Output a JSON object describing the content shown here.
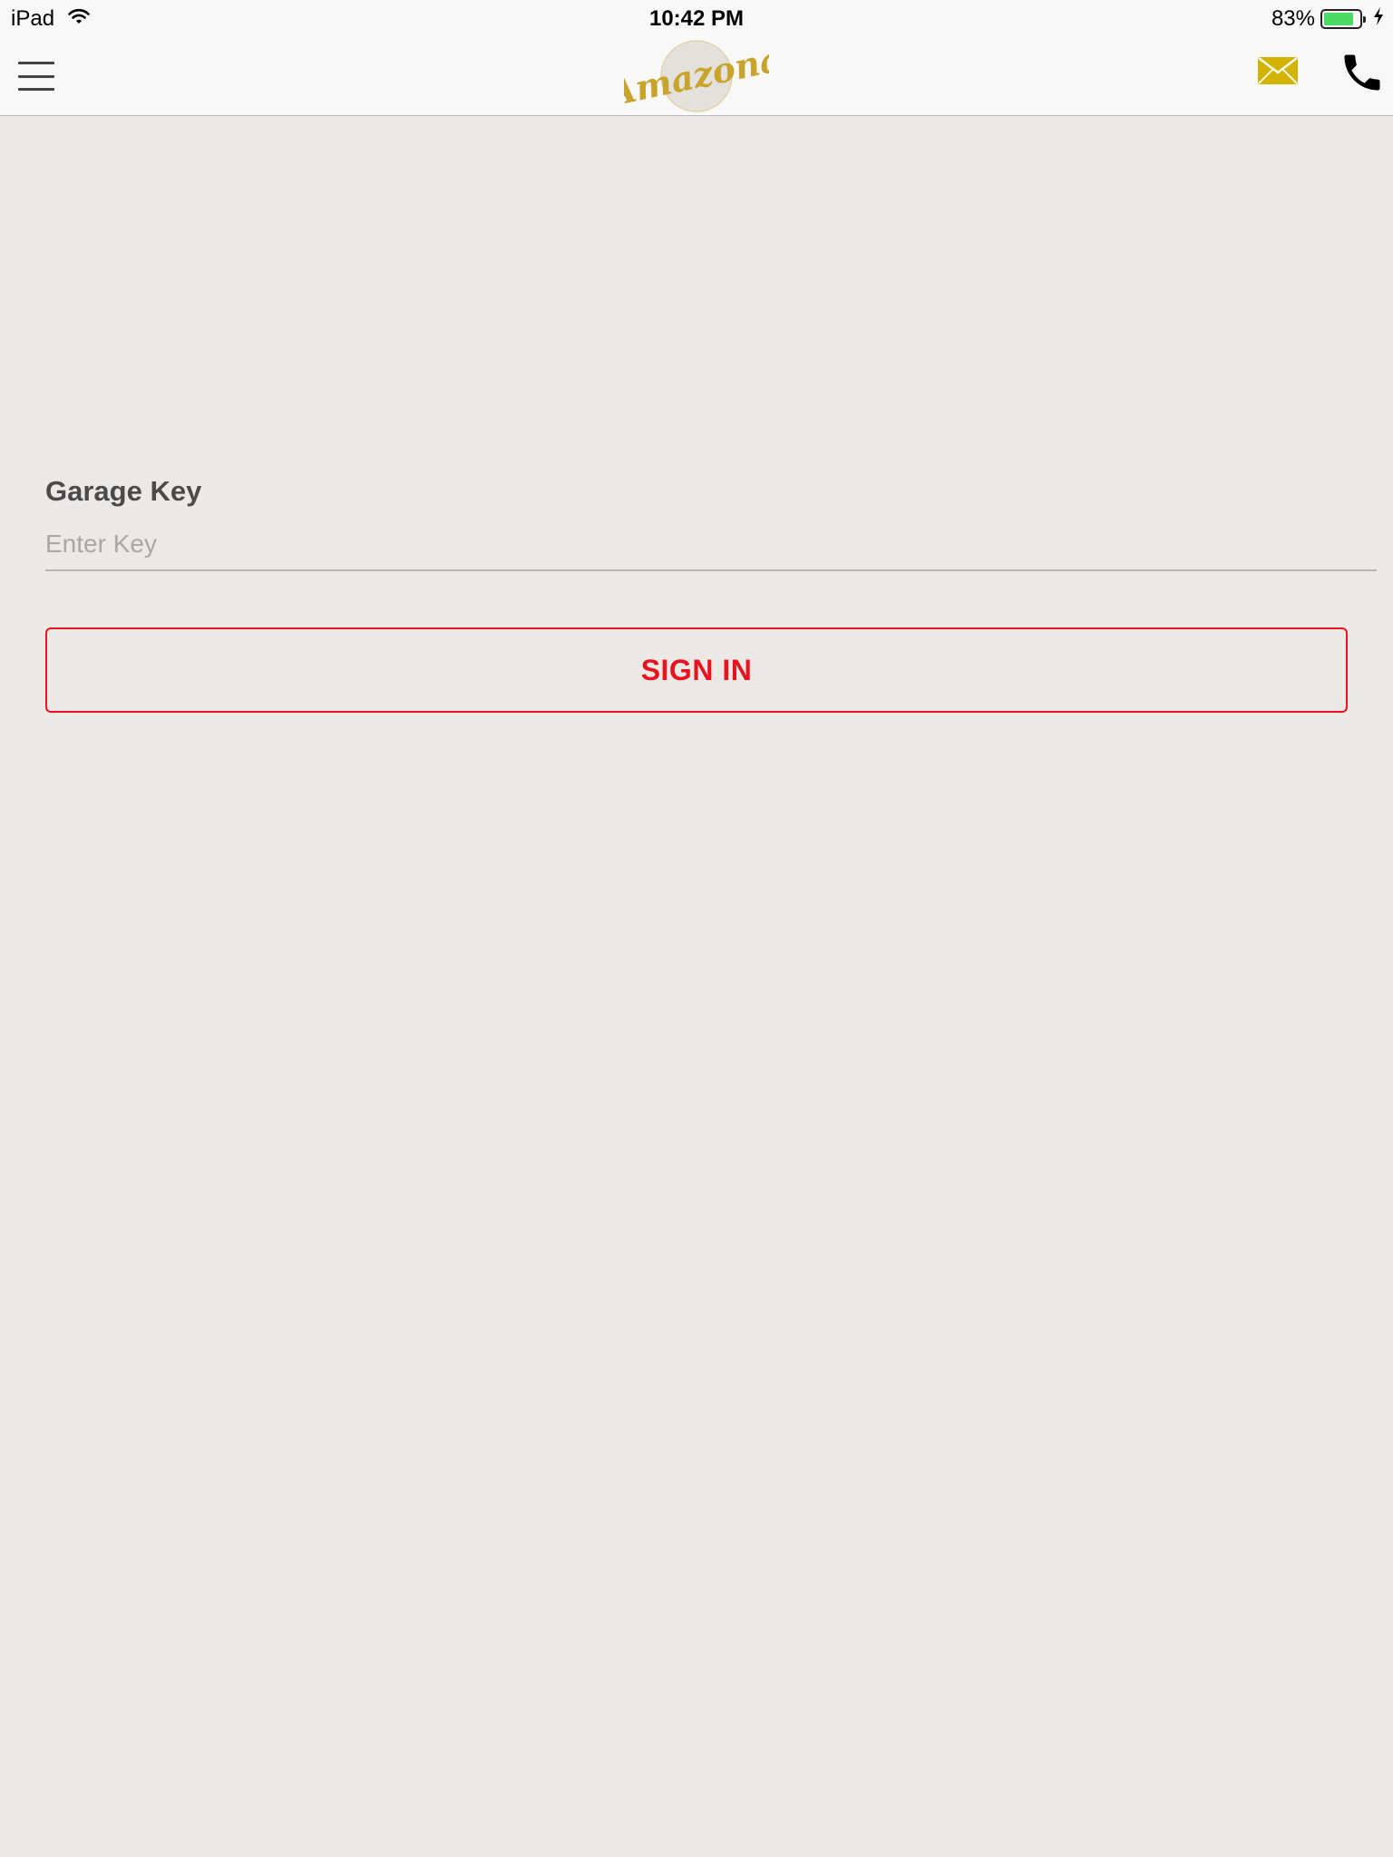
{
  "status_bar": {
    "device": "iPad",
    "time": "10:42 PM",
    "battery_percent": "83%",
    "battery_level": 0.83,
    "icons": [
      "wifi-icon",
      "battery-icon",
      "charging-bolt-icon"
    ]
  },
  "nav": {
    "menu_icon": "hamburger-menu-icon",
    "logo_text": "Amazona",
    "mail_icon": "envelope-icon",
    "phone_icon": "phone-icon",
    "colors": {
      "logo_gold": "#c8a42b",
      "mail_gold": "#d4b300"
    }
  },
  "form": {
    "label": "Garage Key",
    "input_value": "",
    "input_placeholder": "Enter Key",
    "sign_in_label": "SIGN IN",
    "colors": {
      "accent": "#e8131f",
      "background": "#ece8e6"
    }
  }
}
